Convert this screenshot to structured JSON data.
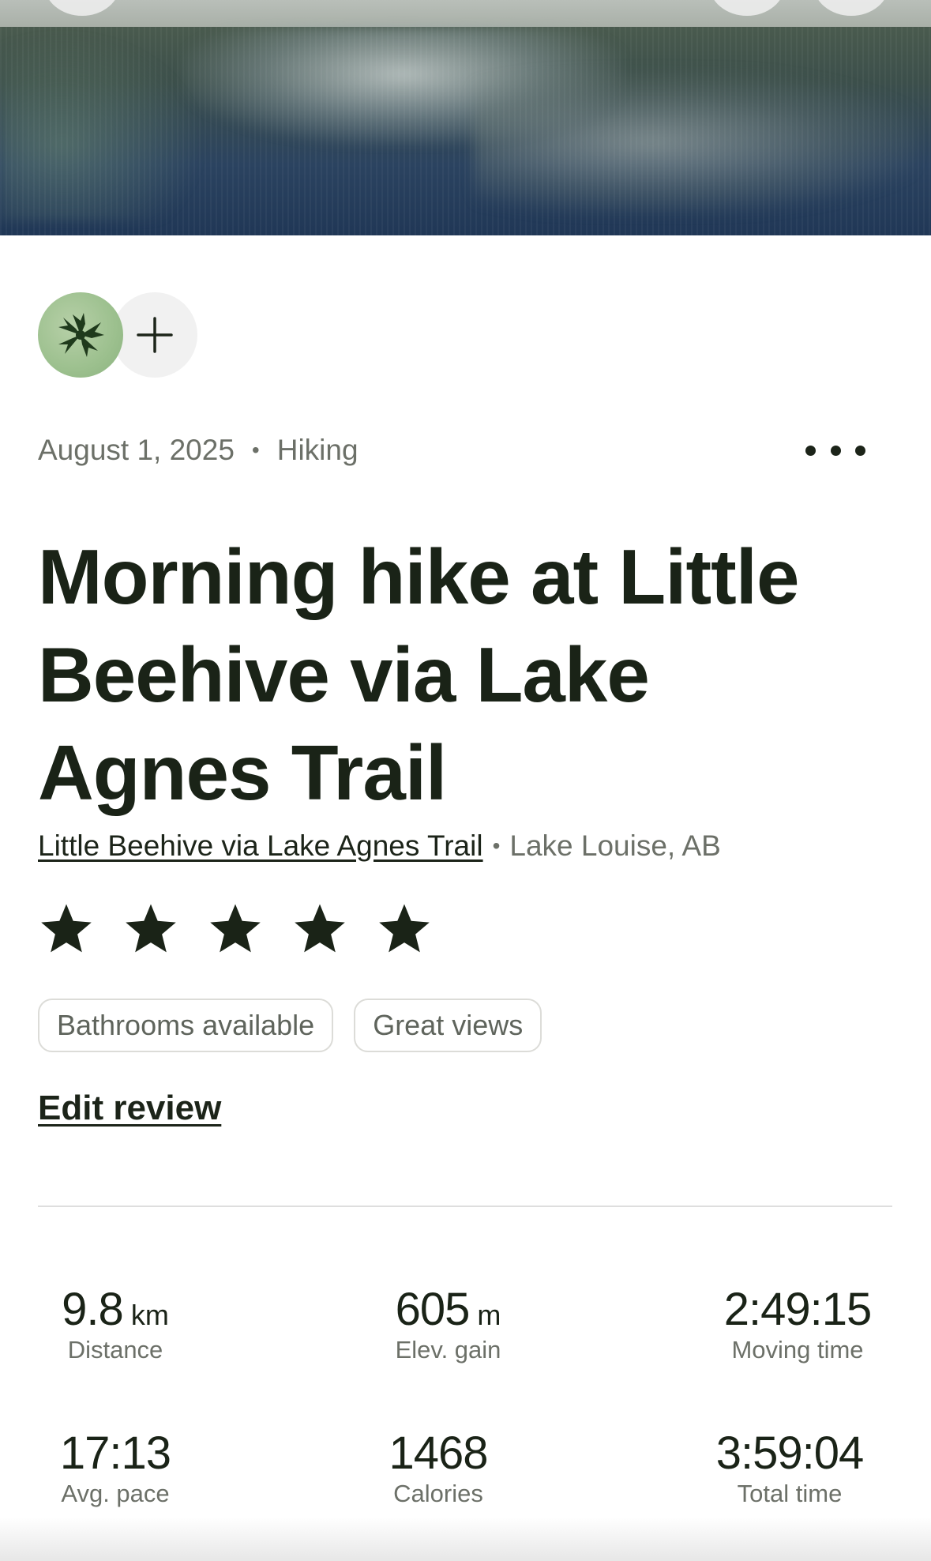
{
  "activity": {
    "date": "August 1, 2025",
    "separator": "•",
    "type": "Hiking",
    "title": "Morning hike at Little Beehive via Lake Agnes Trail",
    "trail_name": "Little Beehive via Lake Agnes Trail",
    "trail_separator": "•",
    "location": "Lake Louise, AB",
    "rating": 5,
    "rating_max": 5
  },
  "tags": [
    "Bathrooms available",
    "Great views"
  ],
  "edit_review_label": "Edit review",
  "stats": [
    {
      "value": "9.8",
      "unit": "km",
      "label": "Distance"
    },
    {
      "value": "605",
      "unit": "m",
      "label": "Elev. gain"
    },
    {
      "value": "2:49:15",
      "unit": "",
      "label": "Moving time"
    },
    {
      "value": "17:13",
      "unit": "",
      "label": "Avg. pace"
    },
    {
      "value": "1468",
      "unit": "",
      "label": "Calories"
    },
    {
      "value": "3:59:04",
      "unit": "",
      "label": "Total time"
    }
  ],
  "icons": {
    "avatar": "leaf-avatar-icon",
    "add": "plus-icon",
    "more": "more-horizontal-icon",
    "star": "star-icon"
  },
  "colors": {
    "text_primary": "#1c2419",
    "text_secondary": "#6c7068",
    "avatar_bg": "#9cc08e",
    "divider": "#dedede"
  }
}
